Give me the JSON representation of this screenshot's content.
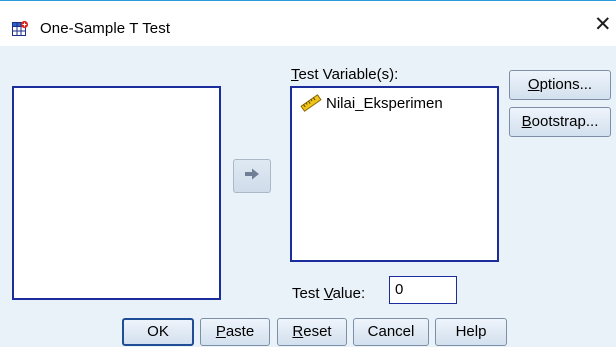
{
  "window": {
    "title": "One-Sample T Test",
    "icon": "spss-dialog-icon",
    "close_glyph": "✕"
  },
  "source_list": {
    "items": []
  },
  "move_button": {
    "icon": "arrow-right-icon"
  },
  "test_variables": {
    "label_prefix": "T",
    "label_rest": "est Variable(s):",
    "items": [
      {
        "label": "Nilai_Eksperimen",
        "icon": "scale-ruler-icon"
      }
    ]
  },
  "side_buttons": {
    "options_prefix": "O",
    "options_rest": "ptions...",
    "bootstrap_prefix": "B",
    "bootstrap_rest": "ootstrap..."
  },
  "test_value": {
    "label_pre": "Test ",
    "label_mnemonic": "V",
    "label_post": "alue:",
    "value": "0"
  },
  "bottom_buttons": {
    "ok": "OK",
    "paste_prefix": "P",
    "paste_rest": "aste",
    "reset_prefix": "R",
    "reset_rest": "eset",
    "cancel": "Cancel",
    "help": "Help"
  },
  "colors": {
    "accent": "#1b2c9c",
    "dialog_bg": "#eaf2f9",
    "titlebar_border": "#2a9ad8"
  }
}
